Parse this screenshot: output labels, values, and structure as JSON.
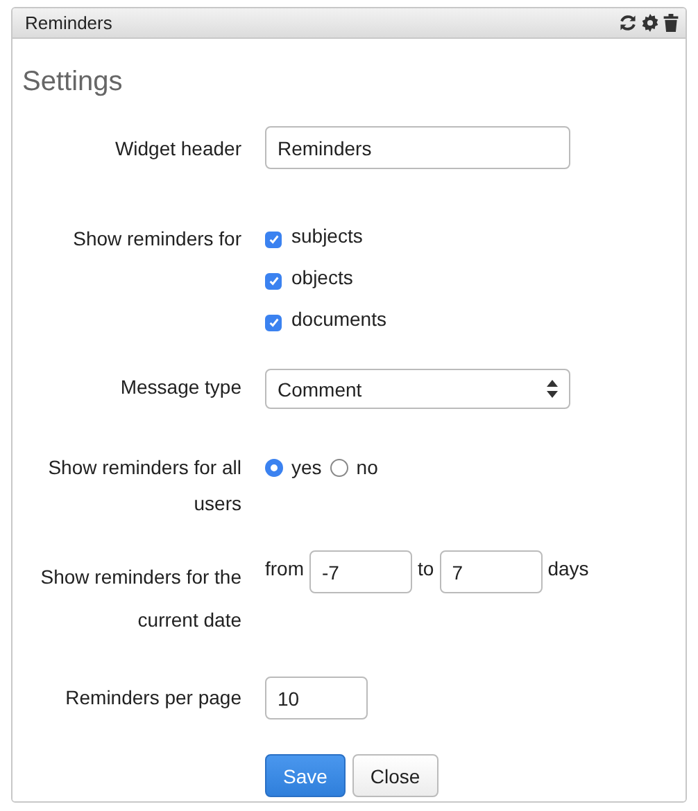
{
  "widget": {
    "title": "Reminders"
  },
  "settings": {
    "title": "Settings",
    "header_label": "Widget header",
    "header_value": "Reminders",
    "show_for_label": "Show reminders for",
    "show_for": [
      {
        "label": "subjects",
        "checked": true
      },
      {
        "label": "objects",
        "checked": true
      },
      {
        "label": "documents",
        "checked": true
      }
    ],
    "message_type_label": "Message type",
    "message_type": "Comment",
    "all_users_label": "Show reminders for all users",
    "all_users": [
      {
        "label": "yes",
        "selected": true
      },
      {
        "label": "no",
        "selected": false
      }
    ],
    "date_label": "Show reminders for the current date",
    "from_label": "from",
    "from_value": "-7",
    "to_label": "to",
    "to_value": "7",
    "days_label": "days",
    "per_page_label": "Reminders per page",
    "per_page": "10",
    "buttons": [
      {
        "label": "Save",
        "kind": "primary"
      },
      {
        "label": "Close",
        "kind": "default"
      }
    ]
  }
}
